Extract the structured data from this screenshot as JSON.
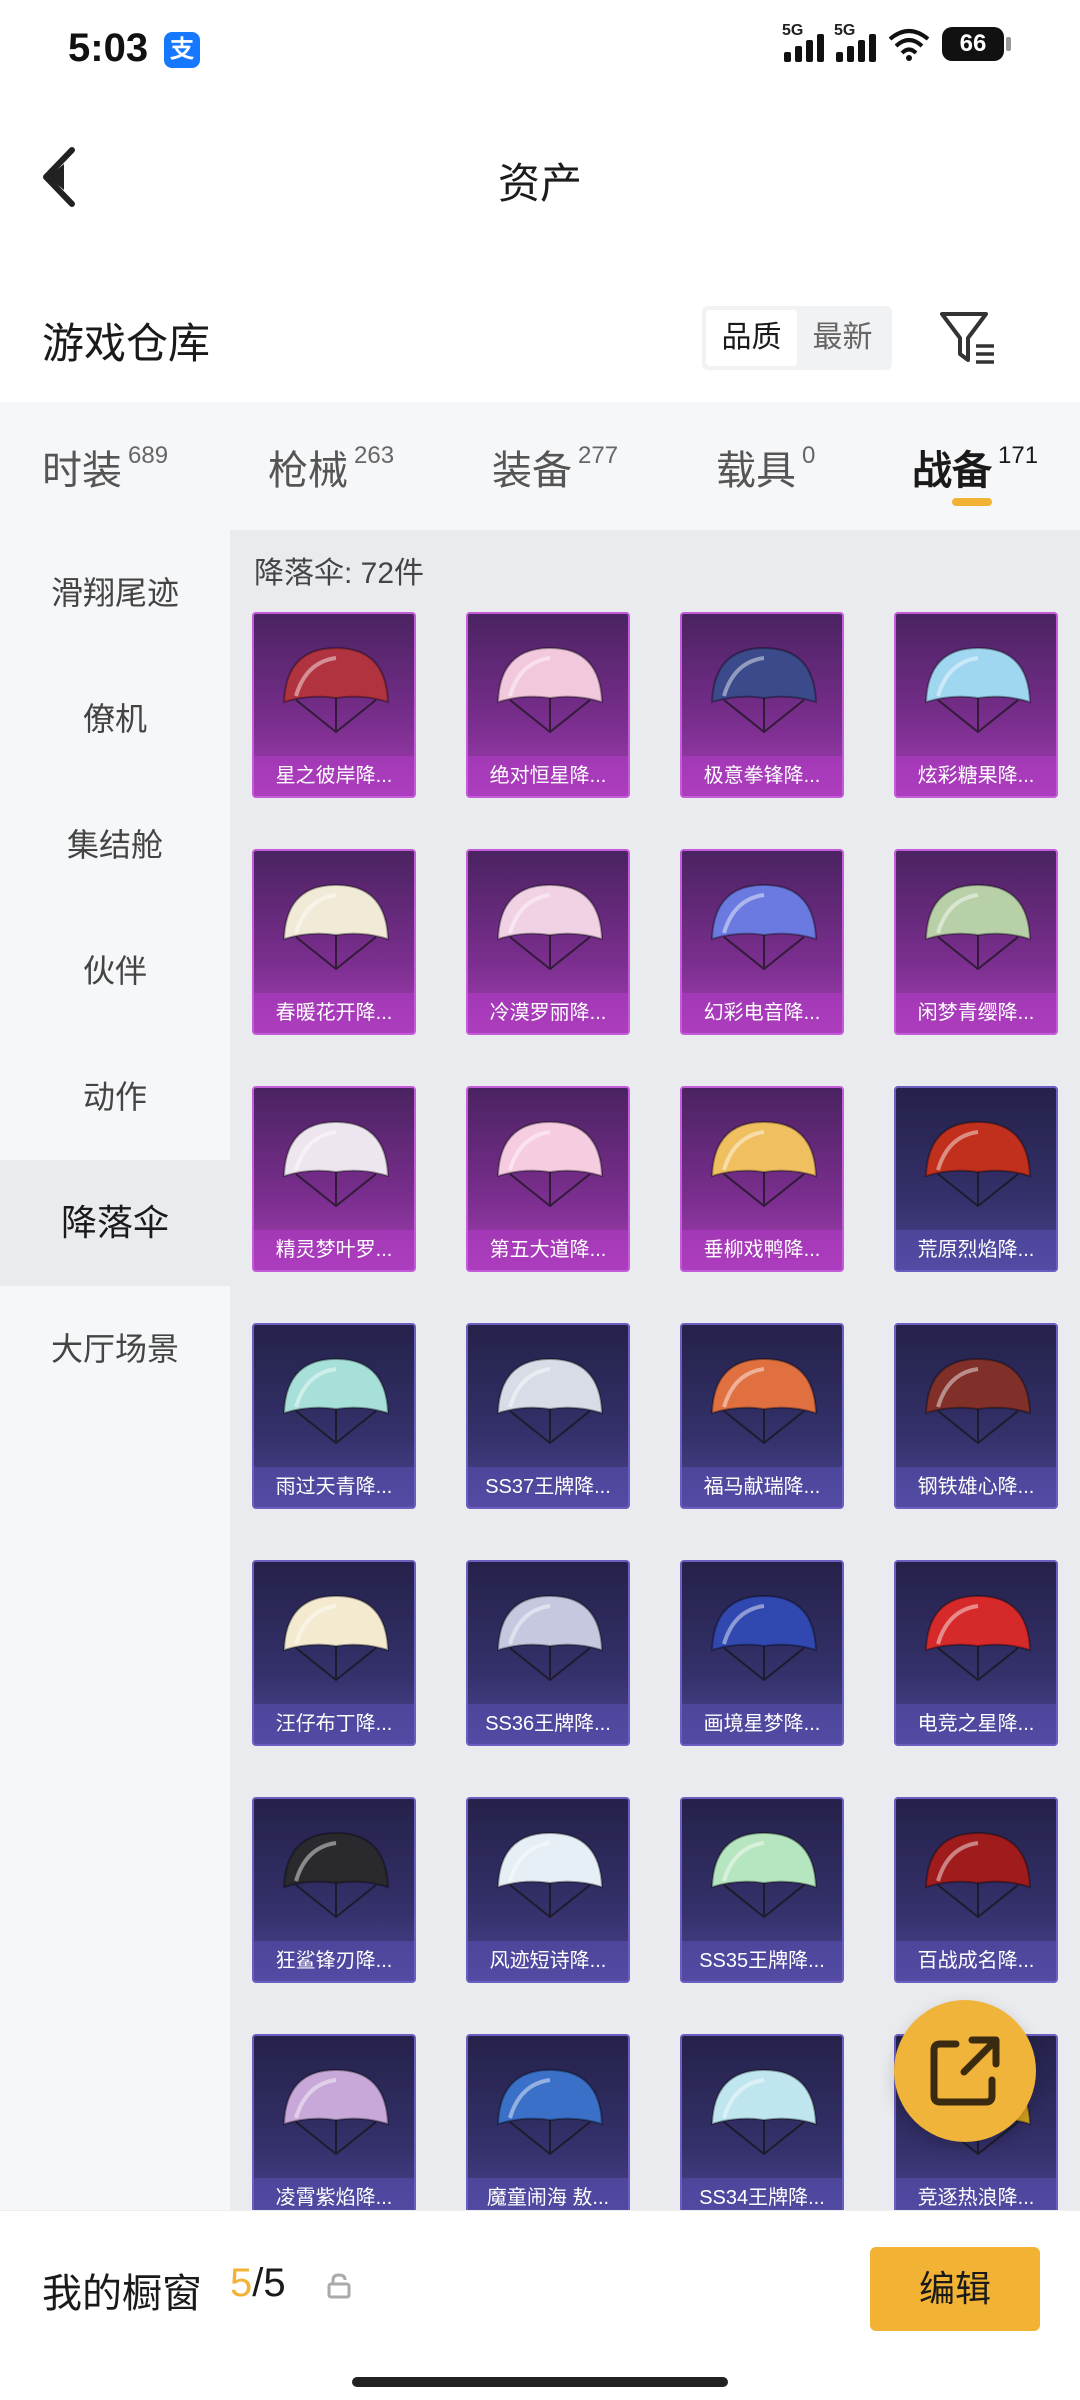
{
  "status_bar": {
    "time": "5:03",
    "alipay_glyph": "支",
    "signal1": "5G",
    "signal2": "5G",
    "battery": "66"
  },
  "header": {
    "title": "资产"
  },
  "warehouse": {
    "title": "游戏仓库",
    "sort_quality": "品质",
    "sort_newest": "最新"
  },
  "categories": [
    {
      "label": "时装",
      "count": "689"
    },
    {
      "label": "枪械",
      "count": "263"
    },
    {
      "label": "装备",
      "count": "277"
    },
    {
      "label": "载具",
      "count": "0"
    },
    {
      "label": "战备",
      "count": "171"
    }
  ],
  "sidebar": {
    "items": [
      "滑翔尾迹",
      "僚机",
      "集结舱",
      "伙伴",
      "动作",
      "降落伞",
      "大厅场景"
    ],
    "active": "降落伞"
  },
  "main": {
    "count_label": "降落伞: 72件"
  },
  "items": [
    {
      "name": "星之彼岸降...",
      "tier": "p",
      "color": "#b0333f"
    },
    {
      "name": "绝对恒星降...",
      "tier": "p",
      "color": "#f2c8dc"
    },
    {
      "name": "极意拳锋降...",
      "tier": "p",
      "color": "#3a4a8a"
    },
    {
      "name": "炫彩糖果降...",
      "tier": "p",
      "color": "#9fd6f0"
    },
    {
      "name": "春暖花开降...",
      "tier": "p",
      "color": "#f1ead6"
    },
    {
      "name": "冷漠罗丽降...",
      "tier": "p",
      "color": "#f0d2e4"
    },
    {
      "name": "幻彩电音降...",
      "tier": "p",
      "color": "#6a7ae0"
    },
    {
      "name": "闲梦青缨降...",
      "tier": "p",
      "color": "#b8d0a8"
    },
    {
      "name": "精灵梦叶罗...",
      "tier": "p",
      "color": "#eee6ef"
    },
    {
      "name": "第五大道降...",
      "tier": "p",
      "color": "#f6cde0"
    },
    {
      "name": "垂柳戏鸭降...",
      "tier": "p",
      "color": "#f0c060"
    },
    {
      "name": "荒原烈焰降...",
      "tier": "b",
      "color": "#c0301c"
    },
    {
      "name": "雨过天青降...",
      "tier": "b",
      "color": "#a6e0d8"
    },
    {
      "name": "SS37王牌降...",
      "tier": "b",
      "color": "#d8dce6"
    },
    {
      "name": "福马献瑞降...",
      "tier": "b",
      "color": "#e07040"
    },
    {
      "name": "钢铁雄心降...",
      "tier": "b",
      "color": "#803028"
    },
    {
      "name": "汪仔布丁降...",
      "tier": "b",
      "color": "#f3ead0"
    },
    {
      "name": "SS36王牌降...",
      "tier": "b",
      "color": "#c6c8e0"
    },
    {
      "name": "画境星梦降...",
      "tier": "b",
      "color": "#3048b0"
    },
    {
      "name": "电竞之星降...",
      "tier": "b",
      "color": "#d62a2a"
    },
    {
      "name": "狂鲨锋刃降...",
      "tier": "b",
      "color": "#2a2a2e"
    },
    {
      "name": "风迹短诗降...",
      "tier": "b",
      "color": "#e6eef6"
    },
    {
      "name": "SS35王牌降...",
      "tier": "b",
      "color": "#b6e6c0"
    },
    {
      "name": "百战成名降...",
      "tier": "b",
      "color": "#a01c1c"
    },
    {
      "name": "凌霄紫焰降...",
      "tier": "b",
      "color": "#c8a8d8"
    },
    {
      "name": "魔童闹海 敖...",
      "tier": "b",
      "color": "#3a70c8"
    },
    {
      "name": "SS34王牌降...",
      "tier": "b",
      "color": "#bfe6ee"
    },
    {
      "name": "竞逐热浪降...",
      "tier": "b",
      "color": "#d4a020"
    }
  ],
  "bottom": {
    "showcase_label": "我的橱窗",
    "used": "5",
    "total": "/5",
    "edit_label": "编辑"
  },
  "colors": {
    "accent": "#f2b233"
  },
  "icons": {
    "back": "back-arrow-icon",
    "filter": "filter-icon",
    "share": "share-icon",
    "lock": "lock-icon"
  }
}
